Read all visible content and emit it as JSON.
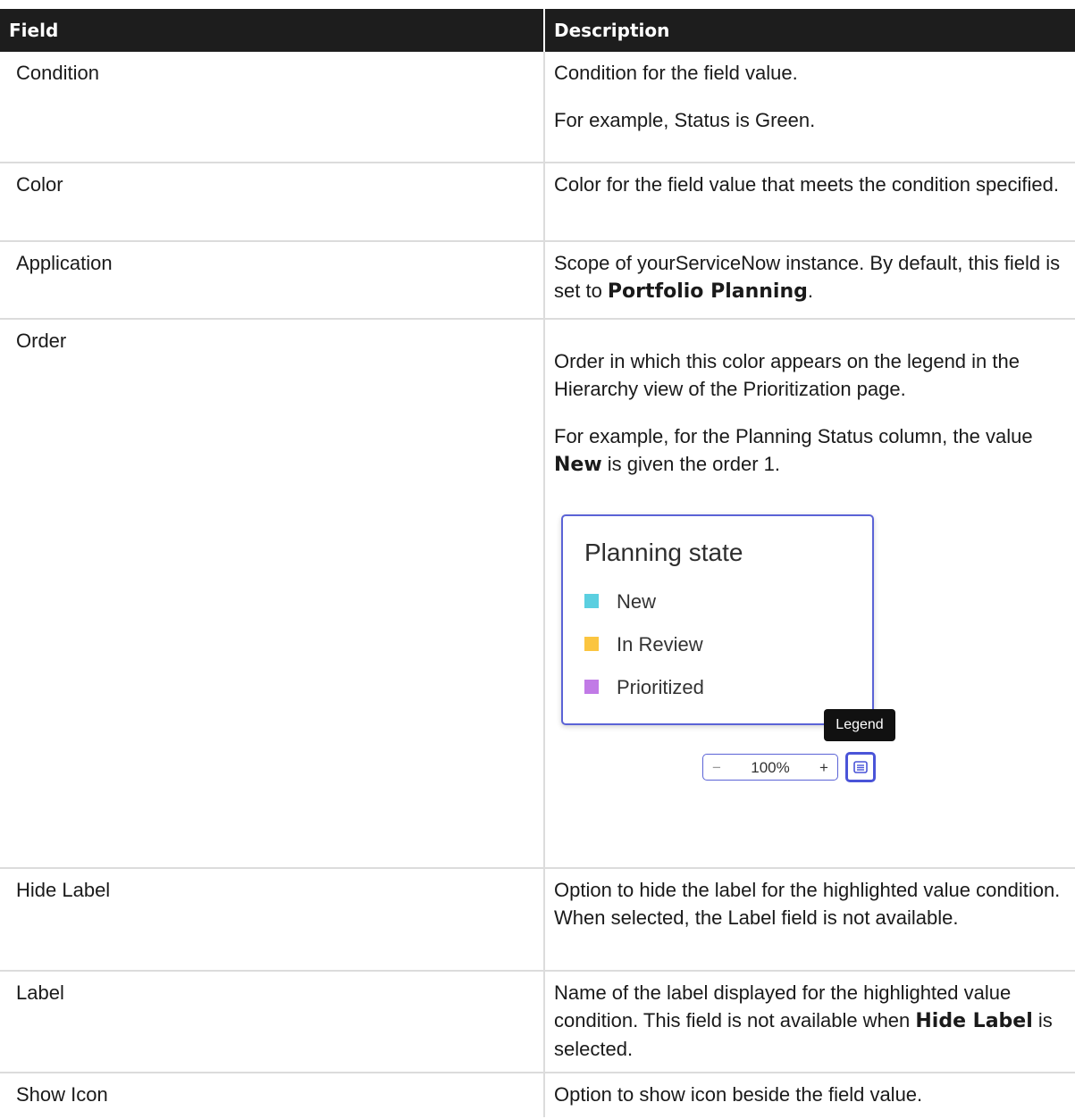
{
  "table": {
    "headers": {
      "field": "Field",
      "description": "Description"
    },
    "rows": [
      {
        "field": "Condition",
        "description": "Condition for the field value.",
        "description_2": "For example, Status is Green."
      },
      {
        "field": "Color",
        "description": "Color for the field value that meets the condition specified."
      },
      {
        "field": "Application",
        "description_prefix": "Scope of yourServiceNow instance. By default, this field is set to ",
        "description_bold": "Portfolio Planning",
        "description_suffix": "."
      },
      {
        "field": "Order",
        "description": "Order in which this color appears on the legend in the Hierarchy view of the Prioritization page.",
        "description_2_prefix": "For example, for the Planning Status column, the value ",
        "description_2_bold": "New",
        "description_2_suffix": " is given the order 1."
      },
      {
        "field": "Hide Label",
        "description": "Option to hide the label for the highlighted value condition. When selected, the Label field is not available."
      },
      {
        "field": "Label",
        "description_prefix": "Name of the label displayed for the highlighted value condition. This field is not available when ",
        "description_bold": "Hide Label",
        "description_suffix": " is selected."
      },
      {
        "field": "Show Icon",
        "description": "Option to show icon beside the field value."
      }
    ]
  },
  "legend_illustration": {
    "title": "Planning state",
    "items": [
      {
        "label": "New",
        "color": "#5bcfe0"
      },
      {
        "label": "In Review",
        "color": "#fbc540"
      },
      {
        "label": "Prioritized",
        "color": "#c17ae6"
      }
    ],
    "tooltip": "Legend",
    "zoom": {
      "minus": "−",
      "value": "100%",
      "plus": "+"
    },
    "legend_icon": "legend-list-icon"
  }
}
